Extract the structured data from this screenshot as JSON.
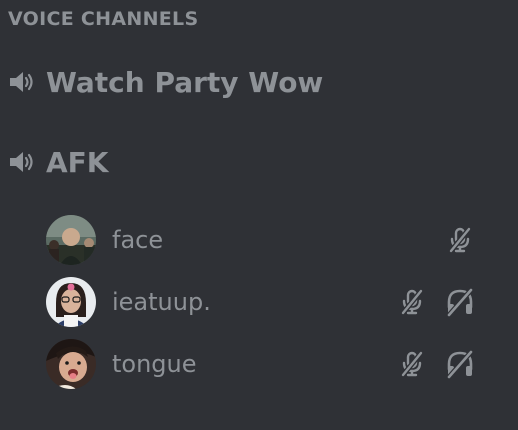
{
  "section": {
    "title": "VOICE CHANNELS"
  },
  "channels": [
    {
      "name": "Watch Party Wow",
      "icon": "speaker-icon"
    },
    {
      "name": "AFK",
      "icon": "speaker-icon"
    }
  ],
  "users": [
    {
      "username": "face",
      "muted": true,
      "deafened": false
    },
    {
      "username": "ieatuup.",
      "muted": true,
      "deafened": true
    },
    {
      "username": "tongue",
      "muted": true,
      "deafened": true
    }
  ],
  "colors": {
    "background": "#2f3136",
    "text_muted": "#8e9297"
  }
}
